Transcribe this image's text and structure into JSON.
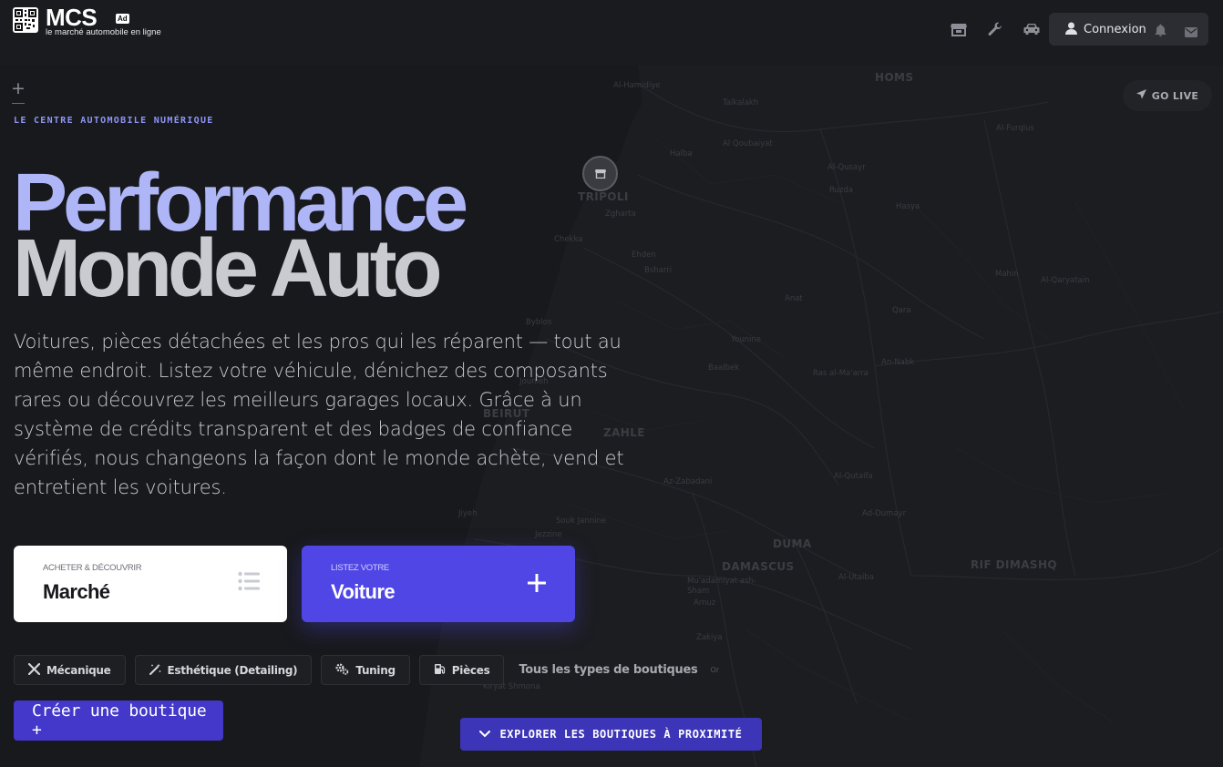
{
  "header": {
    "brand": "MCS",
    "brand_badge": "Ad",
    "tagline": "le marché automobile en ligne",
    "icons": [
      "store-icon",
      "wrench-icon",
      "car-icon"
    ],
    "login_label": "Connexion"
  },
  "map": {
    "go_live_label": "GO LIVE",
    "labels": [
      {
        "text": "HOMS",
        "big": true
      },
      {
        "text": "Al-Hamidiye"
      },
      {
        "text": "Talkalakh"
      },
      {
        "text": "Al Qoubaiyat"
      },
      {
        "text": "Al-Furqlus"
      },
      {
        "text": "Halba"
      },
      {
        "text": "Al-Qusayr"
      },
      {
        "text": "Ruzda"
      },
      {
        "text": "TRIPOLI",
        "big": true
      },
      {
        "text": "Zgharta"
      },
      {
        "text": "Hasya"
      },
      {
        "text": "Chekka"
      },
      {
        "text": "Ehden"
      },
      {
        "text": "Bsharri"
      },
      {
        "text": "Mahin"
      },
      {
        "text": "Al-Qaryatain"
      },
      {
        "text": "Anat"
      },
      {
        "text": "Qara"
      },
      {
        "text": "Byblos"
      },
      {
        "text": "Younine"
      },
      {
        "text": "Baalbek"
      },
      {
        "text": "Ras al-Ma'arra"
      },
      {
        "text": "An-Nabk"
      },
      {
        "text": "Jounieh"
      },
      {
        "text": "BEIRUT",
        "big": true
      },
      {
        "text": "ZAHLE",
        "big": true
      },
      {
        "text": "Az-Zabadani"
      },
      {
        "text": "Al-Qutaifa"
      },
      {
        "text": "Ad-Dumayr"
      },
      {
        "text": "Jiyeh"
      },
      {
        "text": "Souk Jannine"
      },
      {
        "text": "Jezzine"
      },
      {
        "text": "DUMA",
        "big": true
      },
      {
        "text": "DAMASCUS",
        "big": true
      },
      {
        "text": "RIF DIMASHQ",
        "big": true
      },
      {
        "text": "Mu'adamiyat ash-Sham"
      },
      {
        "text": "Al-Utaiba"
      },
      {
        "text": "Arnuz"
      },
      {
        "text": "Zakiya"
      },
      {
        "text": "Kiryat Shmona"
      }
    ]
  },
  "hero": {
    "eyebrow": "LE CENTRE AUTOMOBILE NUMÉRIQUE",
    "title_line1": "Performance",
    "title_line2": "Monde Auto",
    "description": "Voitures, pièces détachées et les pros qui les réparent — tout au même endroit. Listez votre véhicule, dénichez des composants rares ou découvrez les meilleurs garages locaux. Grâce à un système de crédits transparent et des badges de confiance vérifiés, nous changeons la façon dont le monde achète, vend et entretient les voitures."
  },
  "cards": {
    "market": {
      "kicker": "ACHETER & DÉCOUVRIR",
      "title": "Marché"
    },
    "sell": {
      "kicker": "LISTEZ VOTRE",
      "title": "Voiture"
    }
  },
  "categories": {
    "chips": [
      "Mécanique",
      "Esthétique (Detailing)",
      "Tuning",
      "Pièces"
    ],
    "all_link": "Tous les types de boutiques",
    "or_text": "Or"
  },
  "actions": {
    "create_shop": "Créer une boutique +",
    "explore": "EXPLORER LES BOUTIQUES À PROXIMITÉ"
  },
  "colors": {
    "accent": "#4f46e5",
    "title_primary": "#aeb6f8",
    "title_secondary": "#c9cbd1",
    "background": "#1c1d21"
  }
}
